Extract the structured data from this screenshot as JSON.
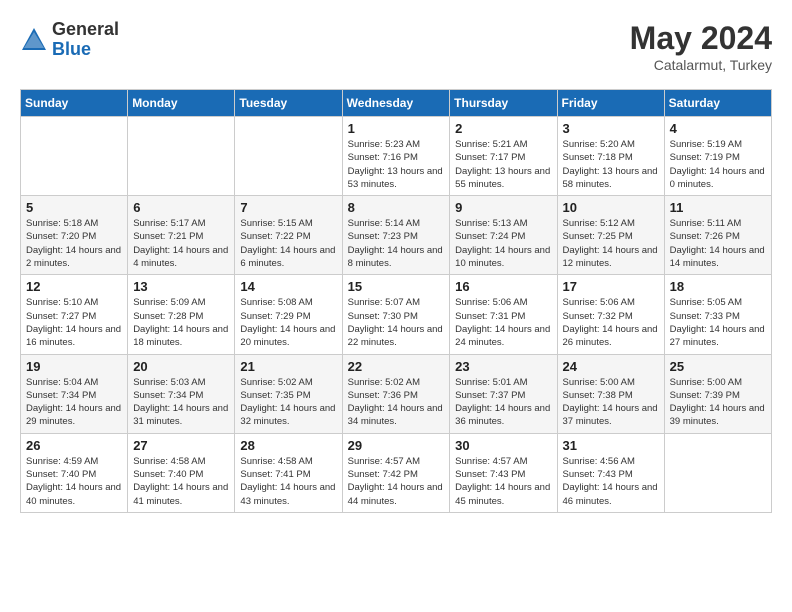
{
  "header": {
    "logo_general": "General",
    "logo_blue": "Blue",
    "title": "May 2024",
    "location": "Catalarmut, Turkey"
  },
  "weekdays": [
    "Sunday",
    "Monday",
    "Tuesday",
    "Wednesday",
    "Thursday",
    "Friday",
    "Saturday"
  ],
  "weeks": [
    [
      {
        "day": "",
        "info": ""
      },
      {
        "day": "",
        "info": ""
      },
      {
        "day": "",
        "info": ""
      },
      {
        "day": "1",
        "info": "Sunrise: 5:23 AM\nSunset: 7:16 PM\nDaylight: 13 hours and 53 minutes."
      },
      {
        "day": "2",
        "info": "Sunrise: 5:21 AM\nSunset: 7:17 PM\nDaylight: 13 hours and 55 minutes."
      },
      {
        "day": "3",
        "info": "Sunrise: 5:20 AM\nSunset: 7:18 PM\nDaylight: 13 hours and 58 minutes."
      },
      {
        "day": "4",
        "info": "Sunrise: 5:19 AM\nSunset: 7:19 PM\nDaylight: 14 hours and 0 minutes."
      }
    ],
    [
      {
        "day": "5",
        "info": "Sunrise: 5:18 AM\nSunset: 7:20 PM\nDaylight: 14 hours and 2 minutes."
      },
      {
        "day": "6",
        "info": "Sunrise: 5:17 AM\nSunset: 7:21 PM\nDaylight: 14 hours and 4 minutes."
      },
      {
        "day": "7",
        "info": "Sunrise: 5:15 AM\nSunset: 7:22 PM\nDaylight: 14 hours and 6 minutes."
      },
      {
        "day": "8",
        "info": "Sunrise: 5:14 AM\nSunset: 7:23 PM\nDaylight: 14 hours and 8 minutes."
      },
      {
        "day": "9",
        "info": "Sunrise: 5:13 AM\nSunset: 7:24 PM\nDaylight: 14 hours and 10 minutes."
      },
      {
        "day": "10",
        "info": "Sunrise: 5:12 AM\nSunset: 7:25 PM\nDaylight: 14 hours and 12 minutes."
      },
      {
        "day": "11",
        "info": "Sunrise: 5:11 AM\nSunset: 7:26 PM\nDaylight: 14 hours and 14 minutes."
      }
    ],
    [
      {
        "day": "12",
        "info": "Sunrise: 5:10 AM\nSunset: 7:27 PM\nDaylight: 14 hours and 16 minutes."
      },
      {
        "day": "13",
        "info": "Sunrise: 5:09 AM\nSunset: 7:28 PM\nDaylight: 14 hours and 18 minutes."
      },
      {
        "day": "14",
        "info": "Sunrise: 5:08 AM\nSunset: 7:29 PM\nDaylight: 14 hours and 20 minutes."
      },
      {
        "day": "15",
        "info": "Sunrise: 5:07 AM\nSunset: 7:30 PM\nDaylight: 14 hours and 22 minutes."
      },
      {
        "day": "16",
        "info": "Sunrise: 5:06 AM\nSunset: 7:31 PM\nDaylight: 14 hours and 24 minutes."
      },
      {
        "day": "17",
        "info": "Sunrise: 5:06 AM\nSunset: 7:32 PM\nDaylight: 14 hours and 26 minutes."
      },
      {
        "day": "18",
        "info": "Sunrise: 5:05 AM\nSunset: 7:33 PM\nDaylight: 14 hours and 27 minutes."
      }
    ],
    [
      {
        "day": "19",
        "info": "Sunrise: 5:04 AM\nSunset: 7:34 PM\nDaylight: 14 hours and 29 minutes."
      },
      {
        "day": "20",
        "info": "Sunrise: 5:03 AM\nSunset: 7:34 PM\nDaylight: 14 hours and 31 minutes."
      },
      {
        "day": "21",
        "info": "Sunrise: 5:02 AM\nSunset: 7:35 PM\nDaylight: 14 hours and 32 minutes."
      },
      {
        "day": "22",
        "info": "Sunrise: 5:02 AM\nSunset: 7:36 PM\nDaylight: 14 hours and 34 minutes."
      },
      {
        "day": "23",
        "info": "Sunrise: 5:01 AM\nSunset: 7:37 PM\nDaylight: 14 hours and 36 minutes."
      },
      {
        "day": "24",
        "info": "Sunrise: 5:00 AM\nSunset: 7:38 PM\nDaylight: 14 hours and 37 minutes."
      },
      {
        "day": "25",
        "info": "Sunrise: 5:00 AM\nSunset: 7:39 PM\nDaylight: 14 hours and 39 minutes."
      }
    ],
    [
      {
        "day": "26",
        "info": "Sunrise: 4:59 AM\nSunset: 7:40 PM\nDaylight: 14 hours and 40 minutes."
      },
      {
        "day": "27",
        "info": "Sunrise: 4:58 AM\nSunset: 7:40 PM\nDaylight: 14 hours and 41 minutes."
      },
      {
        "day": "28",
        "info": "Sunrise: 4:58 AM\nSunset: 7:41 PM\nDaylight: 14 hours and 43 minutes."
      },
      {
        "day": "29",
        "info": "Sunrise: 4:57 AM\nSunset: 7:42 PM\nDaylight: 14 hours and 44 minutes."
      },
      {
        "day": "30",
        "info": "Sunrise: 4:57 AM\nSunset: 7:43 PM\nDaylight: 14 hours and 45 minutes."
      },
      {
        "day": "31",
        "info": "Sunrise: 4:56 AM\nSunset: 7:43 PM\nDaylight: 14 hours and 46 minutes."
      },
      {
        "day": "",
        "info": ""
      }
    ]
  ]
}
